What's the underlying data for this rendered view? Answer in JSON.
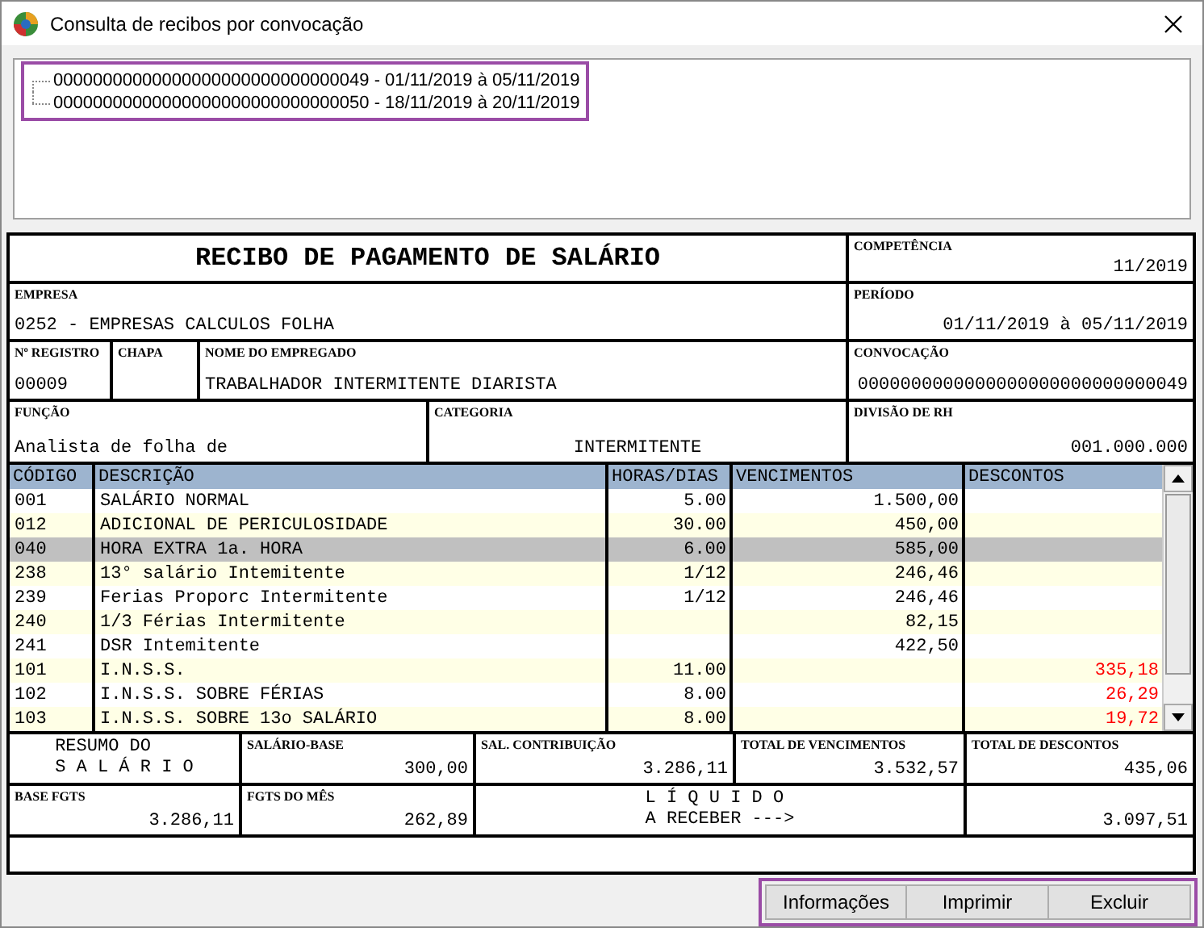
{
  "window": {
    "title": "Consulta de recibos por convocação"
  },
  "convocations": {
    "highlighted": true,
    "items": [
      {
        "label": "00000000000000000000000000000049 - 01/11/2019 à 05/11/2019"
      },
      {
        "label": "00000000000000000000000000000050 - 18/11/2019 à 20/11/2019"
      }
    ]
  },
  "receipt": {
    "header_rows": [
      [
        {
          "kind": "title",
          "value": "RECIBO DE PAGAMENTO DE SALÁRIO"
        },
        {
          "kind": "field",
          "label": "COMPETÊNCIA",
          "value": "11/2019"
        }
      ],
      [
        {
          "kind": "field",
          "label": "EMPRESA",
          "value": "0252 - EMPRESAS CALCULOS FOLHA"
        },
        {
          "kind": "field",
          "label": "PERÍODO",
          "value": "01/11/2019 à 05/11/2019"
        }
      ],
      [
        {
          "kind": "field",
          "label": "Nº REGISTRO",
          "value": "00009"
        },
        {
          "kind": "field",
          "label": "CHAPA"
        },
        {
          "kind": "field",
          "label": "NOME DO EMPREGADO",
          "value": "TRABALHADOR INTERMITENTE DIARISTA"
        },
        {
          "kind": "field",
          "label": "CONVOCAÇÃO",
          "value": "0000000000000000000000000000049"
        }
      ],
      [
        {
          "kind": "field",
          "label": "FUNÇÃO",
          "value": "Analista de folha de"
        },
        {
          "kind": "field",
          "label": "CATEGORIA",
          "value": "INTERMITENTE"
        },
        {
          "kind": "field",
          "label": "DIVISÃO DE RH",
          "value": "001.000.000"
        }
      ]
    ],
    "table": {
      "columns": [
        "CÓDIGO",
        "DESCRIÇÃO",
        "HORAS/DIAS",
        "VENCIMENTOS",
        "DESCONTOS"
      ],
      "rows": [
        {
          "code": "001",
          "description": "SALÁRIO NORMAL",
          "hours": "5.00",
          "earnings": "1.500,00",
          "selected": false
        },
        {
          "code": "012",
          "description": "ADICIONAL DE PERICULOSIDADE",
          "hours": "30.00",
          "earnings": "450,00",
          "selected": false
        },
        {
          "code": "040",
          "description": "HORA EXTRA 1a. HORA",
          "hours": "6.00",
          "earnings": "585,00",
          "selected": true
        },
        {
          "code": "238",
          "description": "13° salário Intemitente",
          "hours": "1/12",
          "earnings": "246,46",
          "selected": false
        },
        {
          "code": "239",
          "description": "Ferias Proporc Intermitente",
          "hours": "1/12",
          "earnings": "246,46",
          "selected": false
        },
        {
          "code": "240",
          "description": "1/3 Férias Intermitente",
          "earnings": "82,15",
          "selected": false
        },
        {
          "code": "241",
          "description": "DSR Intemitente",
          "earnings": "422,50",
          "selected": false
        },
        {
          "code": "101",
          "description": "I.N.S.S.",
          "hours": "11.00",
          "deductions": "335,18",
          "selected": false
        },
        {
          "code": "102",
          "description": "I.N.S.S. SOBRE FÉRIAS",
          "hours": "8.00",
          "deductions": "26,29",
          "selected": false
        },
        {
          "code": "103",
          "description": "I.N.S.S. SOBRE 13o SALÁRIO",
          "hours": "8.00",
          "deductions": "19,72",
          "selected": false
        }
      ]
    },
    "summary_rows": [
      [
        {
          "kind": "title",
          "lines": [
            "RESUMO DO",
            "S A L Á R I O"
          ]
        },
        {
          "kind": "field",
          "label": "SALÁRIO-BASE",
          "value": "300,00"
        },
        {
          "kind": "field",
          "label": "SAL. CONTRIBUIÇÃO",
          "value": "3.286,11"
        },
        {
          "kind": "field",
          "label": "TOTAL DE VENCIMENTOS",
          "value": "3.532,57"
        },
        {
          "kind": "field",
          "label": "TOTAL DE DESCONTOS",
          "value": "435,06"
        }
      ],
      [
        {
          "kind": "field",
          "label": "BASE FGTS",
          "value": "3.286,11"
        },
        {
          "kind": "field",
          "label": "FGTS DO MÊS",
          "value": "262,89"
        },
        {
          "kind": "title",
          "lines": [
            "L Í Q U I D O",
            "A RECEBER --->"
          ]
        },
        {
          "kind": "field",
          "value": "3.097,51"
        }
      ]
    ]
  },
  "buttons": {
    "highlighted": true,
    "items": [
      "Informações",
      "Imprimir",
      "Excluir"
    ]
  }
}
